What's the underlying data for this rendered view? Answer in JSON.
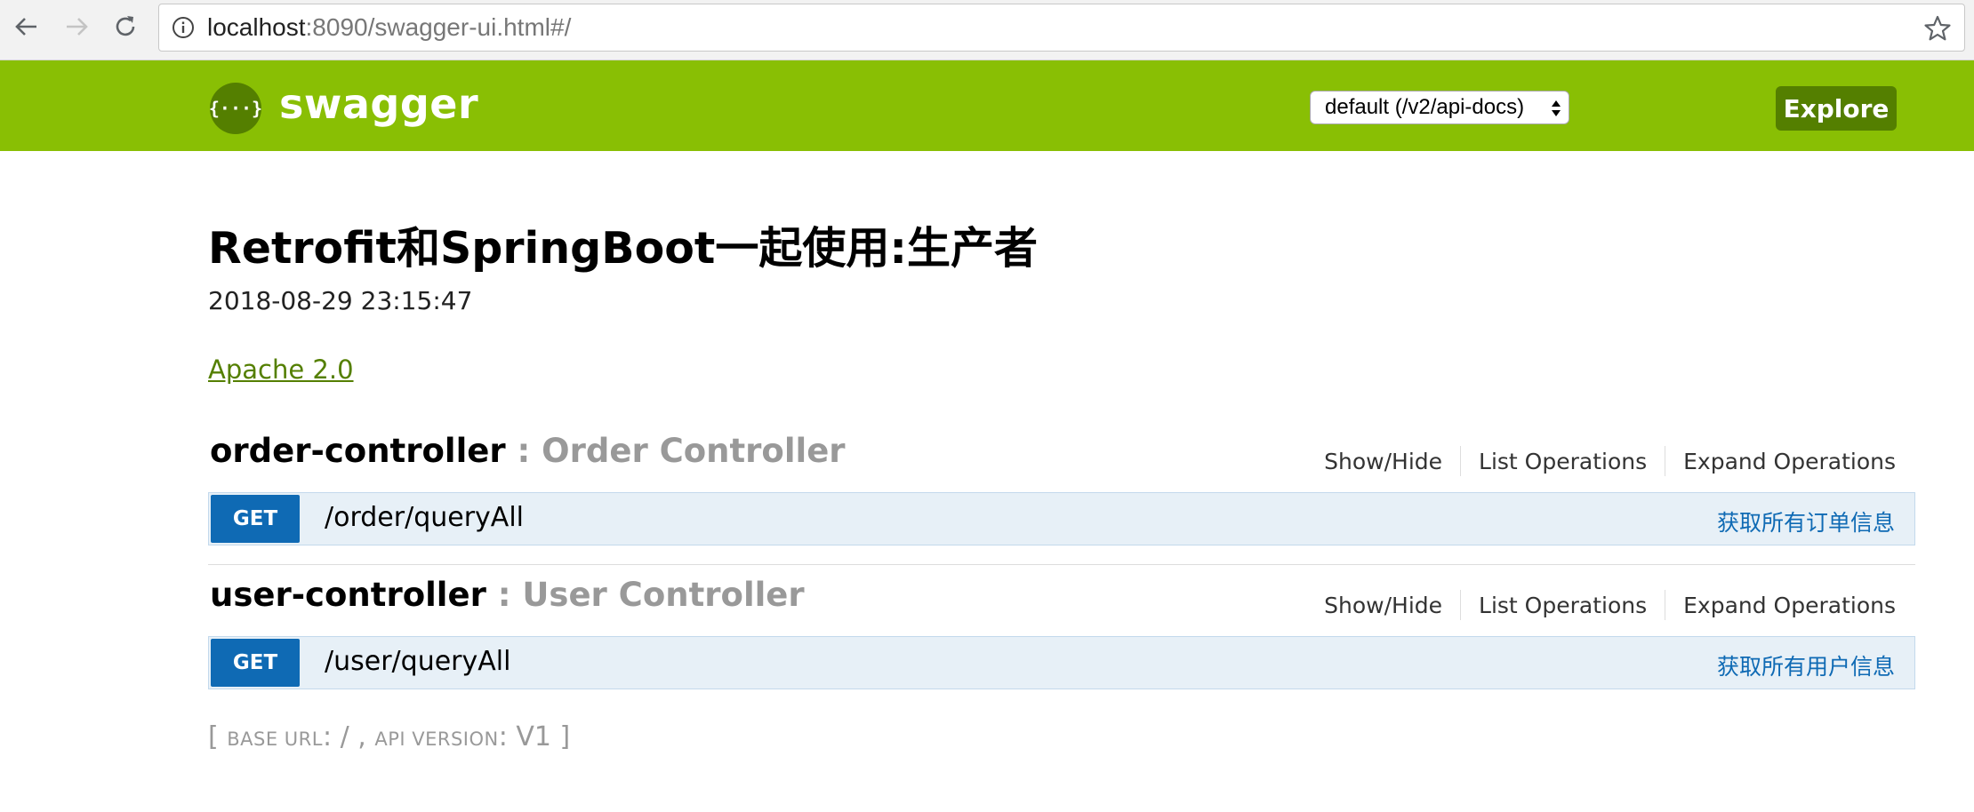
{
  "browser": {
    "url_host": "localhost",
    "url_rest": ":8090/swagger-ui.html#/"
  },
  "header": {
    "logo_glyph": "{···}",
    "title": "swagger",
    "spec_select": "default (/v2/api-docs)",
    "explore_label": "Explore"
  },
  "info": {
    "title": "Retrofit和SpringBoot一起使用:生产者",
    "description": "2018-08-29 23:15:47",
    "license": "Apache 2.0"
  },
  "resources": [
    {
      "name": "order-controller",
      "description": " : Order Controller",
      "links": [
        "Show/Hide",
        "List Operations",
        "Expand Operations"
      ],
      "operation": {
        "method": "GET",
        "path": "/order/queryAll",
        "summary": "获取所有订单信息"
      }
    },
    {
      "name": "user-controller",
      "description": " : User Controller",
      "links": [
        "Show/Hide",
        "List Operations",
        "Expand Operations"
      ],
      "operation": {
        "method": "GET",
        "path": "/user/queryAll",
        "summary": "获取所有用户信息"
      }
    }
  ],
  "footer": {
    "open": "[ ",
    "base_url_label": "BASE URL",
    "base_url_value": ": / , ",
    "api_version_label": "API VERSION",
    "api_version_value": ": V1 ]"
  },
  "colors": {
    "header_green": "#89bf04",
    "dark_green": "#547f00",
    "get_blue": "#0f6ab4",
    "op_bg": "#e7f0f7"
  }
}
